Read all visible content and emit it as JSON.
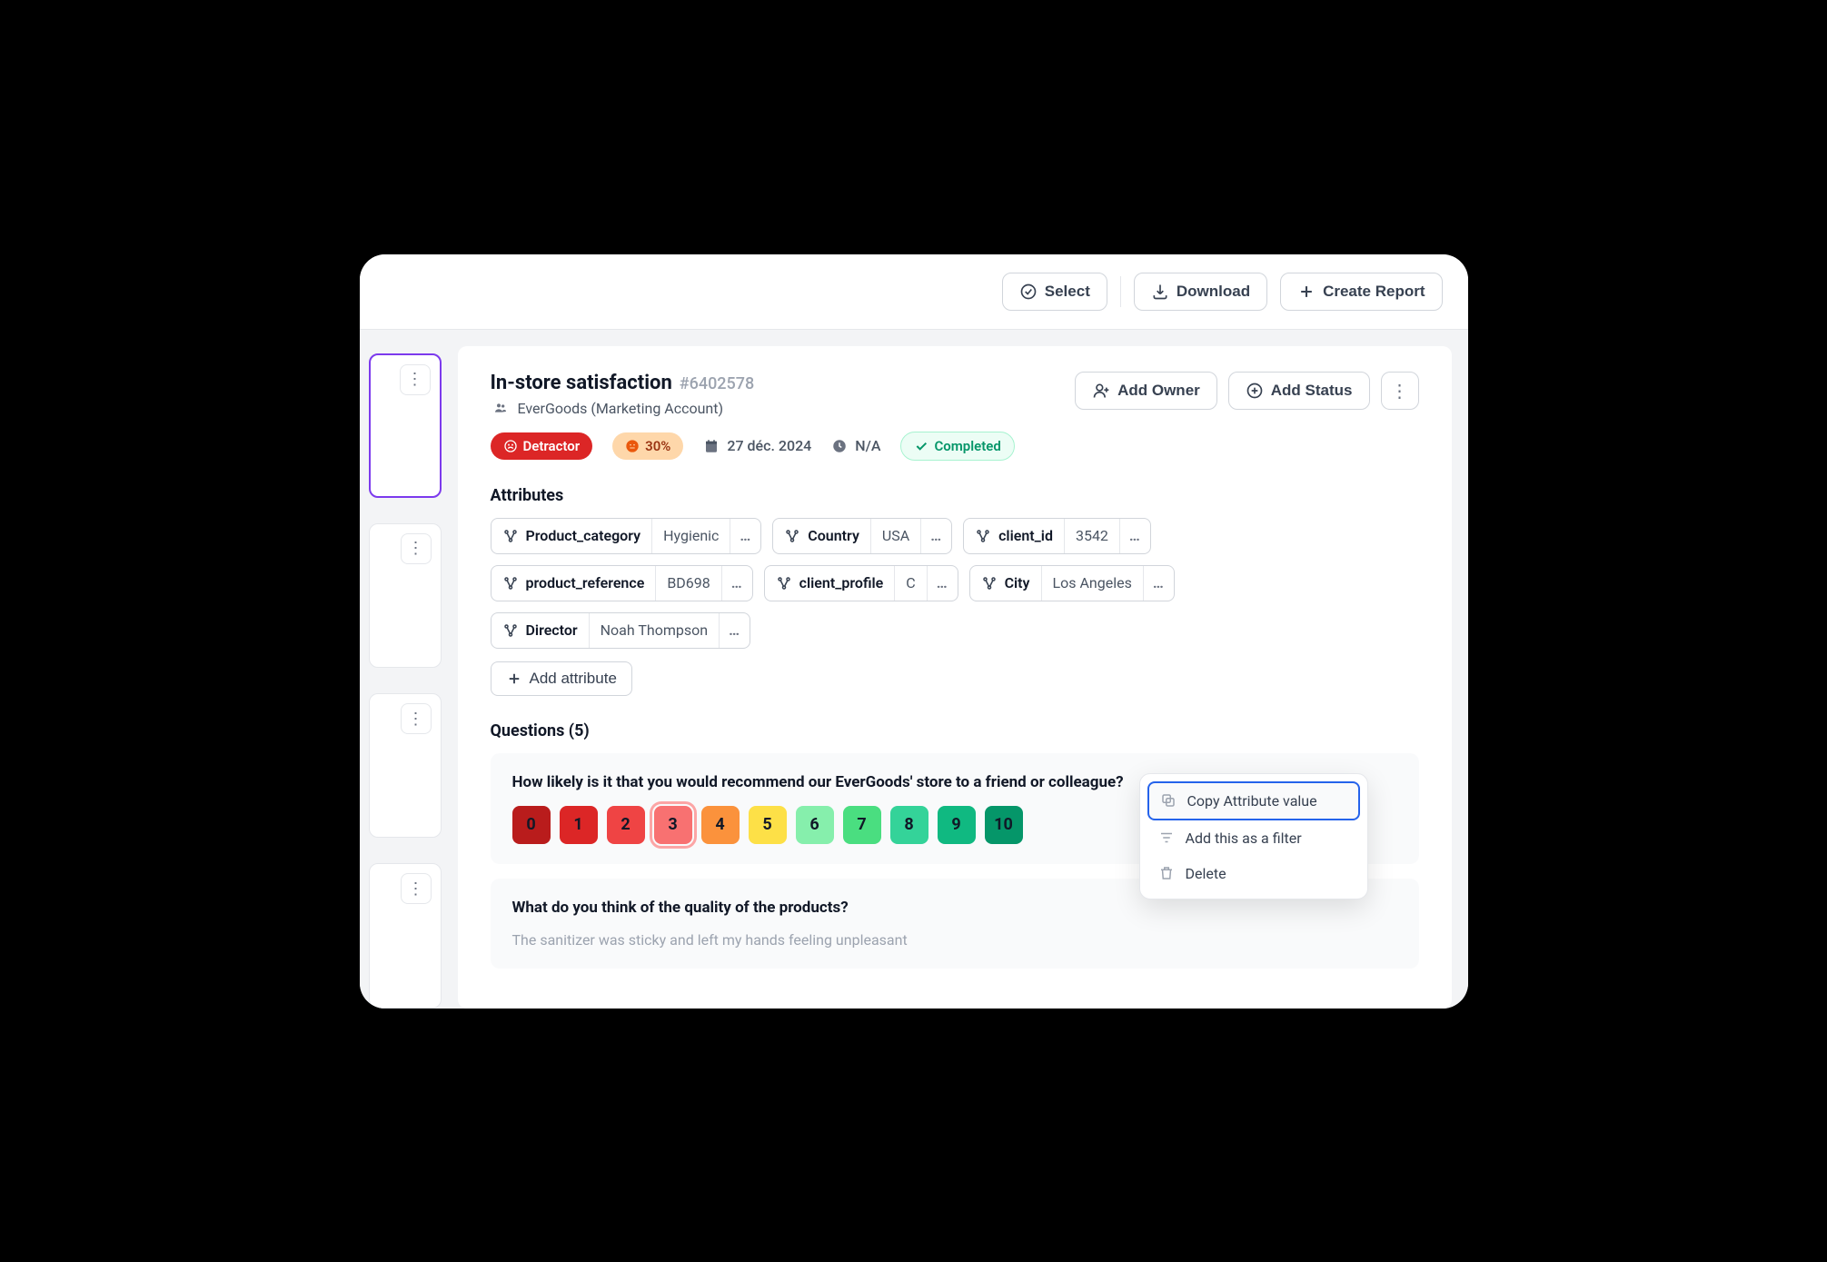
{
  "toolbar": {
    "select": "Select",
    "download": "Download",
    "create_report": "Create Report"
  },
  "header": {
    "title": "In-store satisfaction",
    "id": "#6402578",
    "account": "EverGoods (Marketing Account)",
    "add_owner": "Add Owner",
    "add_status": "Add Status"
  },
  "meta": {
    "detractor": "Detractor",
    "score": "30%",
    "date": "27 déc. 2024",
    "na": "N/A",
    "completed": "Completed"
  },
  "attributes": {
    "title": "Attributes",
    "add_label": "Add attribute",
    "items": [
      {
        "key": "Product_category",
        "value": "Hygienic"
      },
      {
        "key": "Country",
        "value": "USA"
      },
      {
        "key": "client_id",
        "value": "3542"
      },
      {
        "key": "product_reference",
        "value": "BD698"
      },
      {
        "key": "client_profile",
        "value": "C"
      },
      {
        "key": "City",
        "value": "Los Angeles"
      },
      {
        "key": "Director",
        "value": "Noah Thompson"
      }
    ]
  },
  "context_menu": {
    "copy": "Copy Attribute value",
    "filter": "Add this as a filter",
    "delete": "Delete"
  },
  "questions": {
    "title": "Questions (5)",
    "q1": {
      "text": "How likely is it that you would recommend our EverGoods' store to a friend or colleague?",
      "options": [
        "0",
        "1",
        "2",
        "3",
        "4",
        "5",
        "6",
        "7",
        "8",
        "9",
        "10"
      ],
      "selected": 3,
      "colors": [
        "#b91c1c",
        "#dc2626",
        "#ef4444",
        "#f87171",
        "#fb923c",
        "#fde047",
        "#86efac",
        "#4ade80",
        "#34d399",
        "#10b981",
        "#059669"
      ]
    },
    "q2": {
      "text": "What do you think of the quality of the products?",
      "answer_preview": "The sanitizer was sticky and left my hands feeling unpleasant"
    }
  }
}
